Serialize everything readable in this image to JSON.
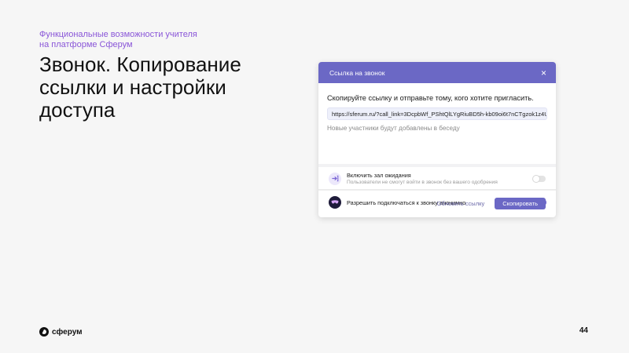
{
  "slide": {
    "subtitle": "Функциональные возможности учителя\nна платформе Сферум",
    "title": "Звонок. Копирование\nссылки и настройки\nдоступа",
    "page_number": "44",
    "logo_text": "сферум"
  },
  "modal": {
    "title": "Ссылка на звонок",
    "close_icon": "×",
    "instruction": "Скопируйте ссылку и отправьте тому, кого хотите пригласить.",
    "link": "https://sferum.ru/?call_link=3DcpbWf_PShtQlLYgRiuBD5h-kb09oi6t7nCTgzok1z4U",
    "note": "Новые участники будут добавлены в беседу",
    "settings": [
      {
        "label": "Включить зал ожидания",
        "hint": "Пользователи не смогут войти в звонок без вашего одобрения",
        "icon": "enter-icon",
        "enabled": false
      },
      {
        "label": "Разрешить подключаться к звонку анонимно",
        "hint": "",
        "icon": "anonymous-mask-icon",
        "enabled": true
      }
    ],
    "refresh_label": "Обновить ссылку",
    "copy_label": "Скопировать"
  },
  "colors": {
    "accent": "#6b68c5",
    "subtitle": "#8a56d8"
  }
}
